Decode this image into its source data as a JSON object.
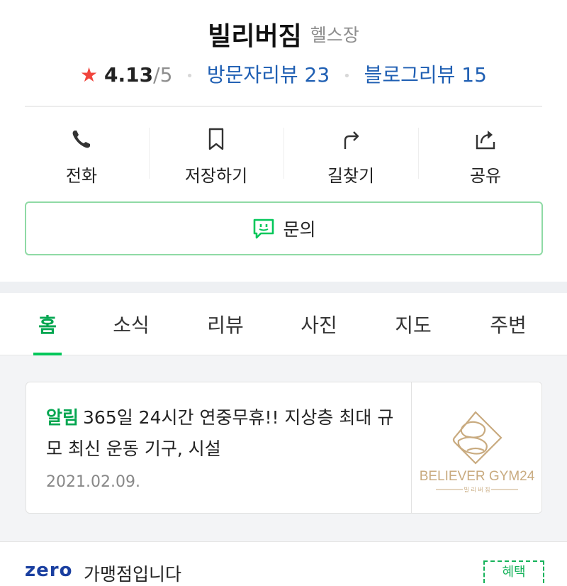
{
  "place": {
    "name": "빌리버짐",
    "category": "헬스장"
  },
  "rating": {
    "star": "★",
    "score": "4.13",
    "max": "/5",
    "separator": "•",
    "visitor_reviews": "방문자리뷰 23",
    "blog_reviews": "블로그리뷰 15"
  },
  "actions": [
    {
      "label": "전화",
      "icon": "phone-icon"
    },
    {
      "label": "저장하기",
      "icon": "bookmark-icon"
    },
    {
      "label": "길찾기",
      "icon": "directions-icon"
    },
    {
      "label": "공유",
      "icon": "share-icon"
    }
  ],
  "inquiry": {
    "label": "문의",
    "icon": "chat-icon"
  },
  "tabs": [
    {
      "label": "홈",
      "active": true
    },
    {
      "label": "소식",
      "active": false
    },
    {
      "label": "리뷰",
      "active": false
    },
    {
      "label": "사진",
      "active": false
    },
    {
      "label": "지도",
      "active": false
    },
    {
      "label": "주변",
      "active": false
    }
  ],
  "notice": {
    "tag": "알림",
    "text": "365일 24시간 연중무휴!! 지상층 최대 규모 최신 운동 기구, 시설",
    "date": "2021.02.09.",
    "logo": {
      "text": "BELIEVER GYM24",
      "subtext": "빌 리 버 짐"
    }
  },
  "next_card": {
    "brand": "zero",
    "text": "가맹점입니다",
    "badge": "혜택"
  },
  "colors": {
    "accent_green": "#03c75a",
    "link_blue": "#1f5fb3",
    "star_red": "#f1453d",
    "logo_gold": "#c9ab80"
  }
}
